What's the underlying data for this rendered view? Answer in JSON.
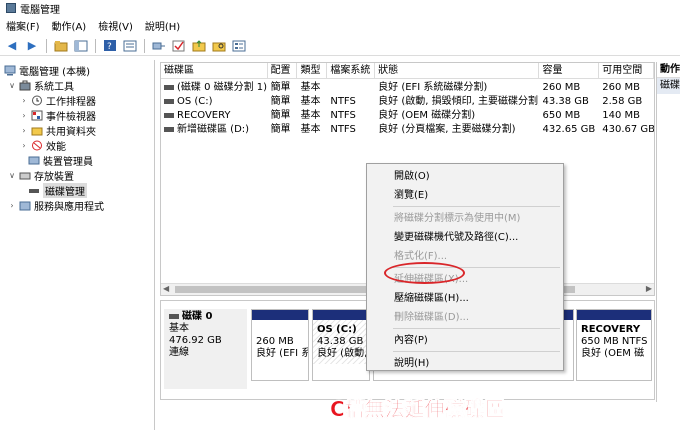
{
  "window": {
    "title": "電腦管理"
  },
  "menu": [
    "檔案(F)",
    "動作(A)",
    "檢視(V)",
    "說明(H)"
  ],
  "toolbar": {
    "icons": [
      "back-arrow-icon",
      "forward-arrow-icon",
      "folder-up-icon",
      "console-tree-icon",
      "help-icon",
      "properties-icon",
      "connect-icon",
      "check-icon",
      "folder-icon",
      "search-folder-icon",
      "details-icon"
    ]
  },
  "tree": {
    "root": "電腦管理 (本機)",
    "system_tools": "系統工具",
    "task_scheduler": "工作排程器",
    "event_viewer": "事件檢視器",
    "shared_folders": "共用資料夾",
    "performance": "效能",
    "device_manager": "裝置管理員",
    "storage": "存放裝置",
    "disk_management": "磁碟管理",
    "services_apps": "服務與應用程式"
  },
  "volumes": {
    "headers": [
      "磁碟區",
      "配置",
      "類型",
      "檔案系統",
      "狀態",
      "容量",
      "可用空間"
    ],
    "rows": [
      [
        "(磁碟 0 磁碟分割 1)",
        "簡單",
        "基本",
        "",
        "良好 (EFI 系統磁碟分割)",
        "260 MB",
        "260 MB"
      ],
      [
        "OS (C:)",
        "簡單",
        "基本",
        "NTFS",
        "良好 (啟動, 損毀傾印, 主要磁碟分割)",
        "43.38 GB",
        "2.58 GB"
      ],
      [
        "RECOVERY",
        "簡單",
        "基本",
        "NTFS",
        "良好 (OEM 磁碟分割)",
        "650 MB",
        "140 MB"
      ],
      [
        "新增磁碟區 (D:)",
        "簡單",
        "基本",
        "NTFS",
        "良好 (分頁檔案, 主要磁碟分割)",
        "432.65 GB",
        "430.67 GB"
      ]
    ]
  },
  "disk": {
    "name": "磁碟 0",
    "type": "基本",
    "size": "476.92 GB",
    "status": "連線",
    "partitions": [
      {
        "name": "",
        "size": "260 MB",
        "status": "良好 (EFI 系"
      },
      {
        "name": "OS  (C:)",
        "size": "43.38 GB N",
        "status": "良好 (啟動,"
      },
      {
        "name": "RECOVERY",
        "size": "650 MB NTFS",
        "status": "良好 (OEM 磁"
      }
    ]
  },
  "action_pane": {
    "header": "動作",
    "sub": "磁碟"
  },
  "context_menu": {
    "items": [
      {
        "label": "開啟(O)",
        "enabled": true
      },
      {
        "label": "瀏覽(E)",
        "enabled": true
      },
      {
        "label": "將磁碟分割標示為使用中(M)",
        "enabled": false
      },
      {
        "label": "變更磁碟機代號及路徑(C)...",
        "enabled": true
      },
      {
        "label": "格式化(F)...",
        "enabled": false
      },
      {
        "label": "延伸磁碟區(X)...",
        "enabled": false
      },
      {
        "label": "壓縮磁碟區(H)...",
        "enabled": true
      },
      {
        "label": "刪除磁碟區(D)...",
        "enabled": false
      },
      {
        "label": "內容(P)",
        "enabled": true
      },
      {
        "label": "說明(H)",
        "enabled": true
      }
    ]
  },
  "annotation": {
    "caption": "C槽無法延伸磁碟區",
    "color": "#e8151f"
  }
}
